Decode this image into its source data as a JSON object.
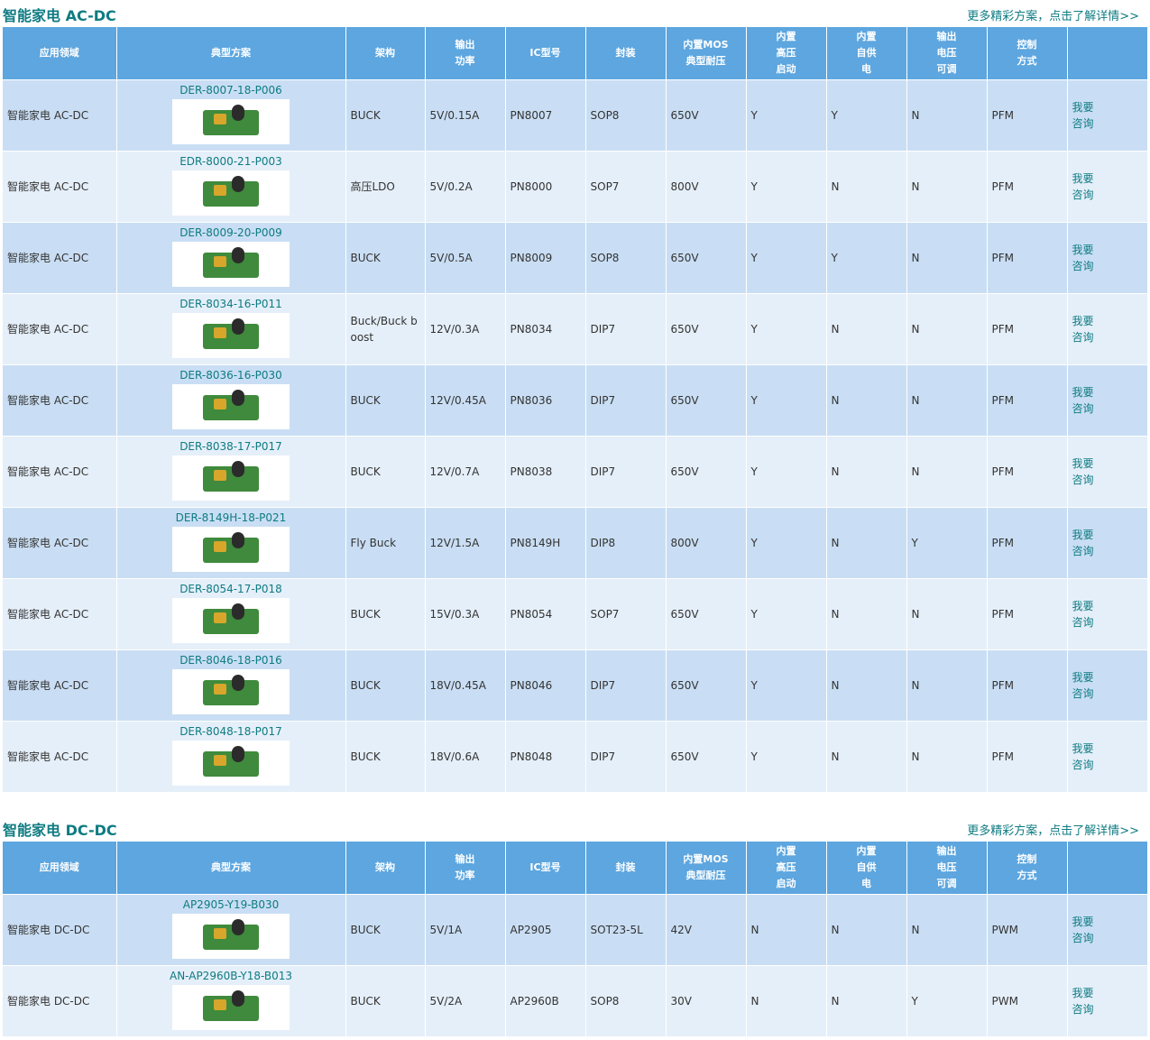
{
  "headers": [
    "应用领域",
    "典型方案",
    "架构",
    "输出\n功率",
    "IC型号",
    "封装",
    "内置MOS\n典型耐压",
    "内置\n高压\n启动",
    "内置\n自供\n电",
    "输出\n电压\n可调",
    "控制\n方式",
    ""
  ],
  "image_icon": "pcb-board-photo",
  "ask_label": "我要\n咨询",
  "colors": {
    "title": "#0e7b82",
    "header_bg": "#5da6df",
    "row_odd": "#c9def4",
    "row_even": "#e5eff9"
  },
  "sections": [
    {
      "title": "智能家电 AC-DC",
      "more": "更多精彩方案，点击了解详情>>",
      "rows": [
        {
          "domain": "智能家电 AC-DC",
          "plan": "DER-8007-18-P006",
          "arch": "BUCK",
          "power": "5V/0.15A",
          "ic": "PN8007",
          "pkg": "SOP8",
          "mos": "650V",
          "hv": "Y",
          "self": "Y",
          "adj": "N",
          "ctrl": "PFM"
        },
        {
          "domain": "智能家电 AC-DC",
          "plan": "EDR-8000-21-P003",
          "arch": "高压LDO",
          "power": "5V/0.2A",
          "ic": "PN8000",
          "pkg": "SOP7",
          "mos": "800V",
          "hv": "Y",
          "self": "N",
          "adj": "N",
          "ctrl": "PFM"
        },
        {
          "domain": "智能家电 AC-DC",
          "plan": "DER-8009-20-P009",
          "arch": "BUCK",
          "power": "5V/0.5A",
          "ic": "PN8009",
          "pkg": "SOP8",
          "mos": "650V",
          "hv": "Y",
          "self": "Y",
          "adj": "N",
          "ctrl": "PFM"
        },
        {
          "domain": "智能家电 AC-DC",
          "plan": "DER-8034-16-P011",
          "arch": "Buck/Buck boost",
          "power": "12V/0.3A",
          "ic": "PN8034",
          "pkg": "DIP7",
          "mos": "650V",
          "hv": "Y",
          "self": "N",
          "adj": "N",
          "ctrl": "PFM"
        },
        {
          "domain": "智能家电 AC-DC",
          "plan": "DER-8036-16-P030",
          "arch": "BUCK",
          "power": "12V/0.45A",
          "ic": "PN8036",
          "pkg": "DIP7",
          "mos": "650V",
          "hv": "Y",
          "self": "N",
          "adj": "N",
          "ctrl": "PFM"
        },
        {
          "domain": "智能家电 AC-DC",
          "plan": "DER-8038-17-P017",
          "arch": "BUCK",
          "power": "12V/0.7A",
          "ic": "PN8038",
          "pkg": "DIP7",
          "mos": "650V",
          "hv": "Y",
          "self": "N",
          "adj": "N",
          "ctrl": "PFM"
        },
        {
          "domain": "智能家电 AC-DC",
          "plan": "DER-8149H-18-P021",
          "arch": "Fly Buck",
          "power": "12V/1.5A",
          "ic": "PN8149H",
          "pkg": "DIP8",
          "mos": "800V",
          "hv": "Y",
          "self": "N",
          "adj": "Y",
          "ctrl": "PFM"
        },
        {
          "domain": "智能家电 AC-DC",
          "plan": "DER-8054-17-P018",
          "arch": "BUCK",
          "power": "15V/0.3A",
          "ic": "PN8054",
          "pkg": "SOP7",
          "mos": "650V",
          "hv": "Y",
          "self": "N",
          "adj": "N",
          "ctrl": "PFM"
        },
        {
          "domain": "智能家电 AC-DC",
          "plan": "DER-8046-18-P016",
          "arch": "BUCK",
          "power": "18V/0.45A",
          "ic": "PN8046",
          "pkg": "DIP7",
          "mos": "650V",
          "hv": "Y",
          "self": "N",
          "adj": "N",
          "ctrl": "PFM"
        },
        {
          "domain": "智能家电 AC-DC",
          "plan": "DER-8048-18-P017",
          "arch": "BUCK",
          "power": "18V/0.6A",
          "ic": "PN8048",
          "pkg": "DIP7",
          "mos": "650V",
          "hv": "Y",
          "self": "N",
          "adj": "N",
          "ctrl": "PFM"
        }
      ]
    },
    {
      "title": "智能家电 DC-DC",
      "more": "更多精彩方案，点击了解详情>>",
      "rows": [
        {
          "domain": "智能家电 DC-DC",
          "plan": "AP2905-Y19-B030",
          "arch": "BUCK",
          "power": "5V/1A",
          "ic": "AP2905",
          "pkg": "SOT23-5L",
          "mos": "42V",
          "hv": "N",
          "self": "N",
          "adj": "N",
          "ctrl": "PWM"
        },
        {
          "domain": "智能家电 DC-DC",
          "plan": "AN-AP2960B-Y18-B013",
          "arch": "BUCK",
          "power": "5V/2A",
          "ic": "AP2960B",
          "pkg": "SOP8",
          "mos": "30V",
          "hv": "N",
          "self": "N",
          "adj": "Y",
          "ctrl": "PWM"
        }
      ]
    }
  ]
}
